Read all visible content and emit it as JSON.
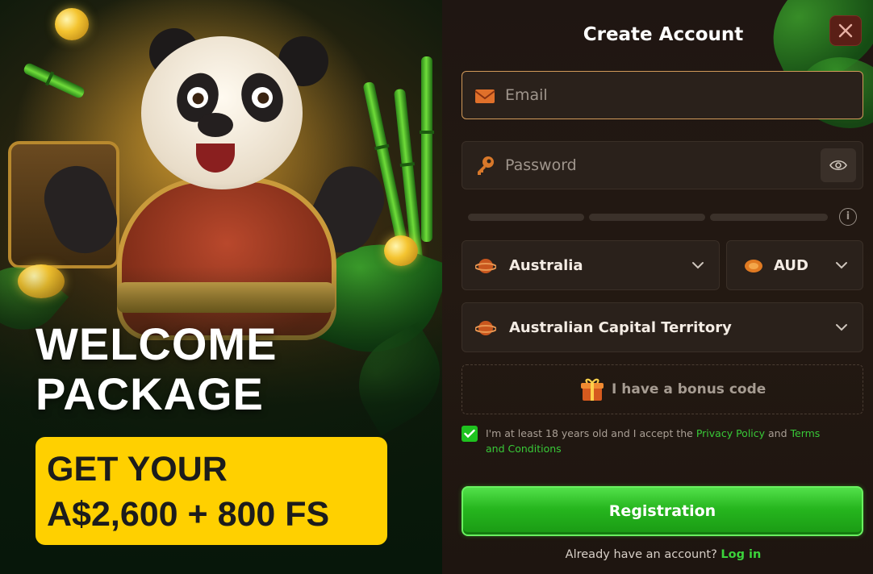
{
  "promo": {
    "headline_line1": "WELCOME",
    "headline_line2": "PACKAGE",
    "offer_line1": "GET YOUR",
    "offer_line2": "A$2,600 + 800 FS"
  },
  "form": {
    "title": "Create Account",
    "email": {
      "placeholder": "Email",
      "icon": "envelope-icon"
    },
    "password": {
      "placeholder": "Password",
      "icon": "key-icon",
      "toggle_icon": "eye-icon"
    },
    "strength_info_icon": "info-icon",
    "country": {
      "value": "Australia",
      "icon": "planet-icon"
    },
    "currency": {
      "value": "AUD",
      "icon": "coin-icon"
    },
    "region": {
      "value": "Australian Capital Territory",
      "icon": "planet-icon"
    },
    "bonus_code_label": "I have a bonus code",
    "terms": {
      "checked": true,
      "prefix": "I'm at least 18 years old and I accept the ",
      "privacy_link": "Privacy Policy",
      "and": " and ",
      "terms_link": "Terms and Conditions"
    },
    "submit_label": "Registration",
    "login_prompt": "Already have an account?",
    "login_link": "Log in"
  },
  "colors": {
    "accent_green": "#26b61e",
    "offer_yellow": "#ffd000",
    "panel_bg": "#231912",
    "close_bg": "#5a1f16"
  }
}
